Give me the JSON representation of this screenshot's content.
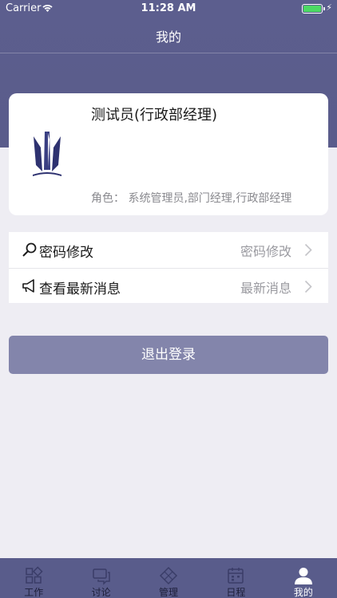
{
  "status_bar": {
    "carrier": "Carrier",
    "time": "11:28 AM"
  },
  "nav": {
    "title": "我的"
  },
  "profile": {
    "name": "测试员(行政部经理)",
    "role": "角色：  系统管理员,部门经理,行政部经理"
  },
  "menu": {
    "items": [
      {
        "icon": "search-key-icon",
        "label": "密码修改",
        "value": "密码修改"
      },
      {
        "icon": "megaphone-icon",
        "label": "查看最新消息",
        "value": "最新消息"
      }
    ]
  },
  "logout": {
    "label": "退出登录"
  },
  "tabs": [
    {
      "icon": "work-grid-icon",
      "label": "工作",
      "active": false
    },
    {
      "icon": "discuss-chat-icon",
      "label": "讨论",
      "active": false
    },
    {
      "icon": "manage-diamond-icon",
      "label": "管理",
      "active": false
    },
    {
      "icon": "calendar-icon",
      "label": "日程",
      "active": false
    },
    {
      "icon": "person-icon",
      "label": "我的",
      "active": true
    }
  ],
  "colors": {
    "header": "#5c5e8e",
    "tab_bar": "#595c8b",
    "logout_button": "#8385ab",
    "background": "#eeedf3",
    "battery": "#4cd964"
  }
}
